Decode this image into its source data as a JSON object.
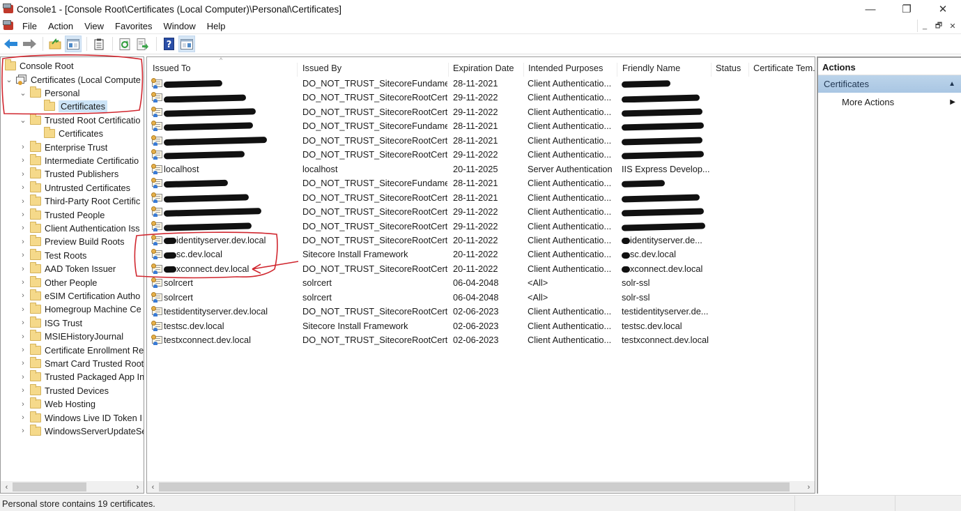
{
  "window": {
    "title": "Console1 - [Console Root\\Certificates (Local Computer)\\Personal\\Certificates]",
    "controls": {
      "minimize": "—",
      "restore": "❐",
      "close": "✕"
    }
  },
  "menu": {
    "items": [
      "File",
      "Action",
      "View",
      "Favorites",
      "Window",
      "Help"
    ],
    "mdi": {
      "minimize": "_",
      "restore": "🗗",
      "close": "✕"
    }
  },
  "toolbar": {
    "buttons": [
      {
        "name": "back",
        "glyph": "⬅",
        "color": "#2b88d8"
      },
      {
        "name": "forward",
        "glyph": "➡",
        "color": "#8a8a8a"
      },
      {
        "name": "up-one-level",
        "glyph": "📁"
      },
      {
        "name": "show-hide-console-tree",
        "glyph": "▤"
      },
      {
        "name": "export-list",
        "glyph": "📋"
      },
      {
        "name": "refresh",
        "glyph": "⟳"
      },
      {
        "name": "export",
        "glyph": "⇨"
      },
      {
        "name": "help",
        "glyph": "?"
      },
      {
        "name": "show-hide-action-pane",
        "glyph": "▥"
      }
    ]
  },
  "tree": {
    "root": "Console Root",
    "computer": "Certificates (Local Compute",
    "items": [
      {
        "label": "Personal",
        "level": 2,
        "expanded": true
      },
      {
        "label": "Certificates",
        "level": 3,
        "selected": true
      },
      {
        "label": "Trusted Root Certificatio",
        "level": 2,
        "expanded": true
      },
      {
        "label": "Certificates",
        "level": 3
      },
      {
        "label": "Enterprise Trust",
        "level": 2
      },
      {
        "label": "Intermediate Certificatio",
        "level": 2
      },
      {
        "label": "Trusted Publishers",
        "level": 2
      },
      {
        "label": "Untrusted Certificates",
        "level": 2
      },
      {
        "label": "Third-Party Root Certific",
        "level": 2
      },
      {
        "label": "Trusted People",
        "level": 2
      },
      {
        "label": "Client Authentication Iss",
        "level": 2
      },
      {
        "label": "Preview Build Roots",
        "level": 2
      },
      {
        "label": "Test Roots",
        "level": 2
      },
      {
        "label": "AAD Token Issuer",
        "level": 2
      },
      {
        "label": "Other People",
        "level": 2
      },
      {
        "label": "eSIM Certification Autho",
        "level": 2
      },
      {
        "label": "Homegroup Machine Ce",
        "level": 2
      },
      {
        "label": "ISG Trust",
        "level": 2
      },
      {
        "label": "MSIEHistoryJournal",
        "level": 2
      },
      {
        "label": "Certificate Enrollment Re",
        "level": 2
      },
      {
        "label": "Smart Card Trusted Root",
        "level": 2
      },
      {
        "label": "Trusted Packaged App In",
        "level": 2
      },
      {
        "label": "Trusted Devices",
        "level": 2
      },
      {
        "label": "Web Hosting",
        "level": 2
      },
      {
        "label": "Windows Live ID Token I",
        "level": 2
      },
      {
        "label": "WindowsServerUpdateSe",
        "level": 2
      }
    ]
  },
  "list": {
    "columns": [
      "Issued To",
      "Issued By",
      "Expiration Date",
      "Intended Purposes",
      "Friendly Name",
      "Status",
      "Certificate Tem..."
    ],
    "rows": [
      {
        "issued_to": "",
        "issued_to_redacted": true,
        "issued_by": "DO_NOT_TRUST_SitecoreFundame...",
        "expiration": "28-11-2021",
        "purposes": "Client Authenticatio...",
        "friendly": "",
        "friendly_redacted": true
      },
      {
        "issued_to": "",
        "issued_to_redacted": true,
        "issued_by": "DO_NOT_TRUST_SitecoreRootCert",
        "expiration": "29-11-2022",
        "purposes": "Client Authenticatio...",
        "friendly": "",
        "friendly_redacted": true
      },
      {
        "issued_to": "",
        "issued_to_redacted": true,
        "issued_by": "DO_NOT_TRUST_SitecoreRootCert",
        "expiration": "29-11-2022",
        "purposes": "Client Authenticatio...",
        "friendly": "",
        "friendly_redacted": true
      },
      {
        "issued_to": "",
        "issued_to_redacted": true,
        "issued_by": "DO_NOT_TRUST_SitecoreFundame...",
        "expiration": "28-11-2021",
        "purposes": "Client Authenticatio...",
        "friendly": "",
        "friendly_redacted": true
      },
      {
        "issued_to": "",
        "issued_to_redacted": true,
        "issued_by": "DO_NOT_TRUST_SitecoreRootCert",
        "expiration": "28-11-2021",
        "purposes": "Client Authenticatio...",
        "friendly": "",
        "friendly_redacted": true
      },
      {
        "issued_to": "",
        "issued_to_redacted": true,
        "issued_by": "DO_NOT_TRUST_SitecoreRootCert",
        "expiration": "29-11-2022",
        "purposes": "Client Authenticatio...",
        "friendly": "",
        "friendly_redacted": true
      },
      {
        "issued_to": "localhost",
        "issued_by": "localhost",
        "expiration": "20-11-2025",
        "purposes": "Server Authentication",
        "friendly": "IIS Express Develop..."
      },
      {
        "issued_to": "",
        "issued_to_redacted": true,
        "issued_by": "DO_NOT_TRUST_SitecoreFundame...",
        "expiration": "28-11-2021",
        "purposes": "Client Authenticatio...",
        "friendly": "",
        "friendly_redacted": true
      },
      {
        "issued_to": "",
        "issued_to_redacted": true,
        "issued_by": "DO_NOT_TRUST_SitecoreRootCert",
        "expiration": "28-11-2021",
        "purposes": "Client Authenticatio...",
        "friendly": "",
        "friendly_redacted": true
      },
      {
        "issued_to": "",
        "issued_to_redacted": true,
        "issued_by": "DO_NOT_TRUST_SitecoreRootCert",
        "expiration": "29-11-2022",
        "purposes": "Client Authenticatio...",
        "friendly": "",
        "friendly_redacted": true
      },
      {
        "issued_to": "",
        "issued_to_redacted": true,
        "issued_by": "DO_NOT_TRUST_SitecoreRootCert",
        "expiration": "29-11-2022",
        "purposes": "Client Authenticatio...",
        "friendly": "",
        "friendly_redacted": true
      },
      {
        "issued_to": "identityserver.dev.local",
        "issued_to_prefix_redacted": true,
        "issued_by": "DO_NOT_TRUST_SitecoreRootCert",
        "expiration": "20-11-2022",
        "purposes": "Client Authenticatio...",
        "friendly": "identityserver.de...",
        "friendly_prefix_redacted": true
      },
      {
        "issued_to": "sc.dev.local",
        "issued_to_prefix_redacted": true,
        "issued_by": "Sitecore Install Framework",
        "expiration": "20-11-2022",
        "purposes": "Client Authenticatio...",
        "friendly": "sc.dev.local",
        "friendly_prefix_redacted": true
      },
      {
        "issued_to": "xconnect.dev.local",
        "issued_to_prefix_redacted": true,
        "issued_by": "DO_NOT_TRUST_SitecoreRootCert",
        "expiration": "20-11-2022",
        "purposes": "Client Authenticatio...",
        "friendly": "xconnect.dev.local",
        "friendly_prefix_redacted": true
      },
      {
        "issued_to": "solrcert",
        "issued_by": "solrcert",
        "expiration": "06-04-2048",
        "purposes": "<All>",
        "friendly": "solr-ssl"
      },
      {
        "issued_to": "solrcert",
        "issued_by": "solrcert",
        "expiration": "06-04-2048",
        "purposes": "<All>",
        "friendly": "solr-ssl"
      },
      {
        "issued_to": "testidentityserver.dev.local",
        "issued_by": "DO_NOT_TRUST_SitecoreRootCert",
        "expiration": "02-06-2023",
        "purposes": "Client Authenticatio...",
        "friendly": "testidentityserver.de..."
      },
      {
        "issued_to": "testsc.dev.local",
        "issued_by": "Sitecore Install Framework",
        "expiration": "02-06-2023",
        "purposes": "Client Authenticatio...",
        "friendly": "testsc.dev.local"
      },
      {
        "issued_to": "testxconnect.dev.local",
        "issued_by": "DO_NOT_TRUST_SitecoreRootCert",
        "expiration": "02-06-2023",
        "purposes": "Client Authenticatio...",
        "friendly": "testxconnect.dev.local"
      }
    ]
  },
  "actions": {
    "title": "Actions",
    "section": "Certificates",
    "items": [
      {
        "label": "More Actions"
      }
    ]
  },
  "status": {
    "text": "Personal store contains 19 certificates."
  },
  "annotation_color": "#d0262e"
}
